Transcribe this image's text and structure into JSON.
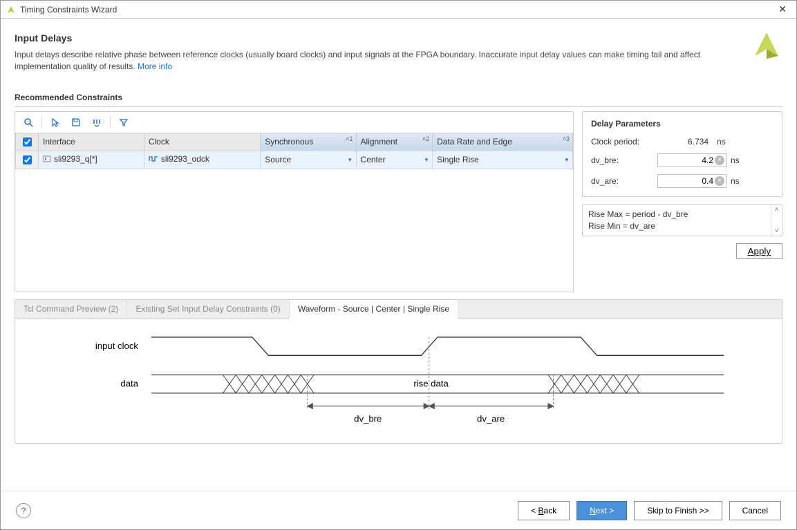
{
  "window": {
    "title": "Timing Constraints Wizard"
  },
  "header": {
    "title": "Input Delays",
    "description": "Input delays describe relative phase between reference clocks (usually board clocks) and input signals at the FPGA boundary. Inaccurate input delay values can make timing fail and affect implementation quality of results.",
    "more_info": "More info"
  },
  "constraints": {
    "section_title": "Recommended Constraints",
    "columns": {
      "interface": "Interface",
      "clock": "Clock",
      "synchronous": "Synchronous",
      "alignment": "Alignment",
      "data_rate": "Data Rate and Edge"
    },
    "sort": {
      "sync": "1",
      "align": "2",
      "rate": "3"
    },
    "rows": [
      {
        "checked": true,
        "interface": "sli9293_q[*]",
        "clock": "sli9293_odck",
        "synchronous": "Source",
        "alignment": "Center",
        "data_rate": "Single Rise"
      }
    ]
  },
  "delay": {
    "title": "Delay Parameters",
    "clock_period_label": "Clock period:",
    "clock_period_value": "6.734",
    "dv_bre_label": "dv_bre:",
    "dv_bre_value": "4.2",
    "dv_are_label": "dv_are:",
    "dv_are_value": "0.4",
    "unit": "ns",
    "formula_line1": "Rise Max = period - dv_bre",
    "formula_line2": "Rise Min = dv_are",
    "apply": "Apply"
  },
  "tabs": {
    "tcl": "Tcl Command Preview (2)",
    "existing": "Existing Set Input Delay Constraints (0)",
    "waveform": "Waveform - Source | Center | Single Rise"
  },
  "waveform": {
    "input_clock": "input clock",
    "data": "data",
    "rise_data": "rise data",
    "dv_bre": "dv_bre",
    "dv_are": "dv_are"
  },
  "footer": {
    "back": "Back",
    "next": "Next >",
    "skip": "Skip to Finish >>",
    "cancel": "Cancel"
  }
}
